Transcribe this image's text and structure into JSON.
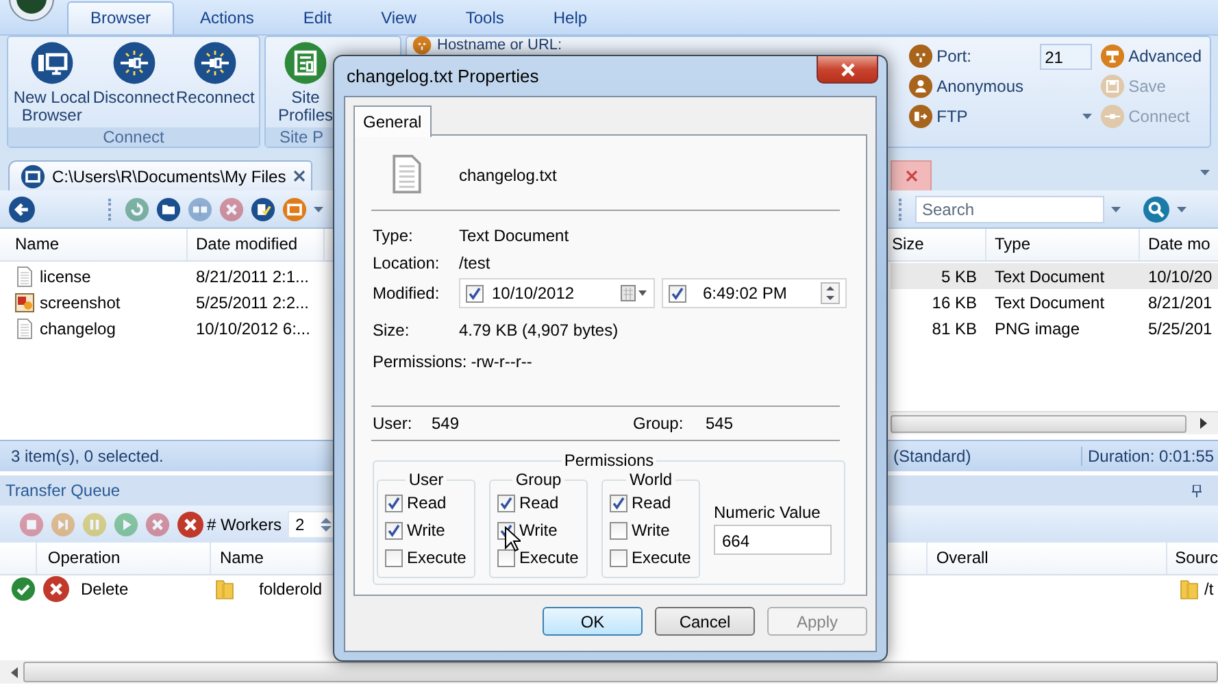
{
  "menu": {
    "tabs": [
      {
        "label": "Browser",
        "selected": true
      },
      {
        "label": "Actions",
        "selected": false
      },
      {
        "label": "Edit",
        "selected": false
      },
      {
        "label": "View",
        "selected": false
      },
      {
        "label": "Tools",
        "selected": false
      },
      {
        "label": "Help",
        "selected": false
      }
    ]
  },
  "ribbon": {
    "connect_group": {
      "title": "Connect",
      "buttons": [
        {
          "label": "New Local Browser",
          "kind": "monitor"
        },
        {
          "label": "Disconnect",
          "kind": "plug"
        },
        {
          "label": "Reconnect",
          "kind": "plug"
        }
      ]
    },
    "site_group": {
      "title": "Site P",
      "buttons": [
        {
          "label": "Site Profiles"
        }
      ]
    },
    "host_label": "Hostname or URL:",
    "port_label": "Port:",
    "port_value": "21",
    "anonymous_label": "Anonymous",
    "protocol": "FTP",
    "actions": [
      {
        "label": "Advanced",
        "kind": "advanced",
        "disabled": false
      },
      {
        "label": "Save",
        "kind": "save",
        "disabled": true
      },
      {
        "label": "Connect",
        "kind": "connect",
        "disabled": true
      }
    ]
  },
  "local_pane": {
    "tab": {
      "label": "C:\\Users\\R\\Documents\\My Files"
    },
    "columns": [
      "Name",
      "Date modified"
    ],
    "rows": [
      {
        "kind": "text",
        "name": "license",
        "date": "8/21/2011 2:1..."
      },
      {
        "kind": "image",
        "name": "screenshot",
        "date": "5/25/2011 2:2..."
      },
      {
        "kind": "text",
        "name": "changelog",
        "date": "10/10/2012 6:..."
      }
    ],
    "status": "3 item(s), 0 selected."
  },
  "remote_pane": {
    "search": {
      "placeholder": "Search"
    },
    "columns": [
      "Size",
      "Type",
      "Date mo"
    ],
    "rows": [
      {
        "size": "5 KB",
        "type": "Text Document",
        "date": "10/10/20",
        "selected": true
      },
      {
        "size": "16 KB",
        "type": "Text Document",
        "date": "8/21/201",
        "selected": false
      },
      {
        "size": "81 KB",
        "type": "PNG image",
        "date": "5/25/201",
        "selected": false
      }
    ],
    "status": [
      "(Standard)",
      "Duration: 0:01:55"
    ]
  },
  "transfer_queue": {
    "title": "Transfer Queue",
    "workers_label": "# Workers",
    "workers": "2",
    "columns": [
      "Operation",
      "Name",
      "Overall",
      "Sourc"
    ],
    "rows": [
      {
        "kind": "done",
        "operation": "Delete",
        "name": "folderold",
        "source": "/t"
      }
    ]
  },
  "dialog": {
    "title": "changelog.txt Properties",
    "tabs": [
      {
        "label": "General",
        "selected": true
      }
    ],
    "file_name": "changelog.txt",
    "fields": [
      {
        "label": "Type:",
        "value": "Text Document"
      },
      {
        "label": "Location:",
        "value": "/test"
      }
    ],
    "modified": {
      "label": "Modified:",
      "date": "10/10/2012",
      "date_checked": true,
      "time": "6:49:02 PM",
      "time_checked": true
    },
    "size": {
      "label": "Size:",
      "value": "4.79 KB (4,907 bytes)"
    },
    "permissions_text": {
      "label": "Permissions:",
      "value": "-rw-r--r--"
    },
    "owner": {
      "user_label": "User:",
      "user": "549",
      "group_label": "Group:",
      "group": "545"
    },
    "permissions": {
      "title": "Permissions",
      "groups": [
        {
          "title": "User",
          "options": [
            {
              "label": "Read",
              "checked": true
            },
            {
              "label": "Write",
              "checked": true
            },
            {
              "label": "Execute",
              "checked": false
            }
          ]
        },
        {
          "title": "Group",
          "options": [
            {
              "label": "Read",
              "checked": true
            },
            {
              "label": "Write",
              "checked": true
            },
            {
              "label": "Execute",
              "checked": false
            }
          ]
        },
        {
          "title": "World",
          "options": [
            {
              "label": "Read",
              "checked": true
            },
            {
              "label": "Write",
              "checked": false
            },
            {
              "label": "Execute",
              "checked": false
            }
          ]
        }
      ],
      "numeric_label": "Numeric Value",
      "numeric_value": "664"
    },
    "buttons": [
      {
        "label": "OK",
        "default": true,
        "disabled": false
      },
      {
        "label": "Cancel",
        "default": false,
        "disabled": false
      },
      {
        "label": "Apply",
        "default": false,
        "disabled": true
      }
    ]
  }
}
